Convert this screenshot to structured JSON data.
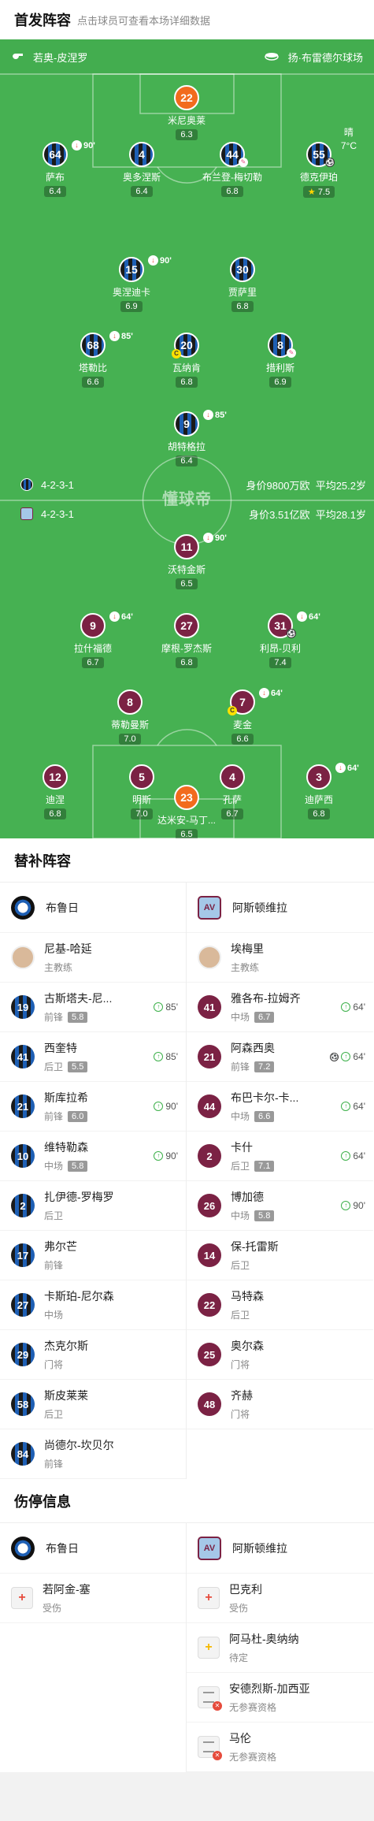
{
  "header": {
    "title": "首发阵容",
    "subtitle": "点击球员可查看本场详细数据"
  },
  "pitch": {
    "home_coach_label": "若奥-皮涅罗",
    "venue": "扬·布雷德尔球场",
    "weather": "晴",
    "temperature": "7°C",
    "watermark": "懂球帝",
    "home_formation": {
      "formation": "4-2-3-1",
      "value": "身价9800万欧",
      "age": "平均25.2岁"
    },
    "away_formation": {
      "formation": "4-2-3-1",
      "value": "身价3.51亿欧",
      "age": "平均28.1岁"
    },
    "home_players": [
      {
        "number": "22",
        "name": "米尼奥莱",
        "rating": "6.3"
      },
      {
        "number": "64",
        "name": "萨布",
        "rating": "6.4",
        "sub_minute": "90'"
      },
      {
        "number": "4",
        "name": "奥多涅斯",
        "rating": "6.4"
      },
      {
        "number": "44",
        "name": "布兰登-梅切勒",
        "rating": "6.8"
      },
      {
        "number": "55",
        "name": "德克伊珀",
        "rating": "7.5"
      },
      {
        "number": "15",
        "name": "奥涅迪卡",
        "rating": "6.9",
        "sub_minute": "90'"
      },
      {
        "number": "30",
        "name": "贾萨里",
        "rating": "6.8"
      },
      {
        "number": "68",
        "name": "塔勒比",
        "rating": "6.6",
        "sub_minute": "85'"
      },
      {
        "number": "20",
        "name": "瓦纳肯",
        "rating": "6.8"
      },
      {
        "number": "8",
        "name": "措利斯",
        "rating": "6.9"
      },
      {
        "number": "9",
        "name": "胡特格拉",
        "rating": "6.4",
        "sub_minute": "85'"
      }
    ],
    "away_players": [
      {
        "number": "11",
        "name": "沃特金斯",
        "rating": "6.5",
        "sub_minute": "90'"
      },
      {
        "number": "9",
        "name": "拉什福德",
        "rating": "6.7",
        "sub_minute": "64'"
      },
      {
        "number": "27",
        "name": "摩根-罗杰斯",
        "rating": "6.8"
      },
      {
        "number": "31",
        "name": "利昂-贝利",
        "rating": "7.4",
        "sub_minute": "64'"
      },
      {
        "number": "8",
        "name": "蒂勒曼斯",
        "rating": "7.0"
      },
      {
        "number": "7",
        "name": "麦金",
        "rating": "6.6",
        "sub_minute": "64'"
      },
      {
        "number": "12",
        "name": "迪涅",
        "rating": "6.8"
      },
      {
        "number": "5",
        "name": "明斯",
        "rating": "7.0"
      },
      {
        "number": "4",
        "name": "孔萨",
        "rating": "6.7"
      },
      {
        "number": "3",
        "name": "迪萨西",
        "rating": "6.8",
        "sub_minute": "64'"
      },
      {
        "number": "23",
        "name": "达米安-马丁...",
        "rating": "6.5"
      }
    ]
  },
  "subs": {
    "title": "替补阵容",
    "home_team": "布鲁日",
    "away_team": "阿斯顿维拉",
    "away_logo_text": "AV",
    "home_coach": {
      "name": "尼基-哈延",
      "role": "主教练"
    },
    "away_coach": {
      "name": "埃梅里",
      "role": "主教练"
    },
    "home": [
      {
        "number": "19",
        "name": "古斯塔夫-尼...",
        "pos": "前锋",
        "rating": "5.8",
        "minute": "85'"
      },
      {
        "number": "41",
        "name": "西奎特",
        "pos": "后卫",
        "rating": "5.5",
        "minute": "85'"
      },
      {
        "number": "21",
        "name": "斯库拉希",
        "pos": "前锋",
        "rating": "6.0",
        "minute": "90'"
      },
      {
        "number": "10",
        "name": "维特勒森",
        "pos": "中场",
        "rating": "5.8",
        "minute": "90'"
      },
      {
        "number": "2",
        "name": "扎伊德-罗梅罗",
        "pos": "后卫"
      },
      {
        "number": "17",
        "name": "弗尔芒",
        "pos": "前锋"
      },
      {
        "number": "27",
        "name": "卡斯珀-尼尔森",
        "pos": "中场"
      },
      {
        "number": "29",
        "name": "杰克尔斯",
        "pos": "门将"
      },
      {
        "number": "58",
        "name": "斯皮莱莱",
        "pos": "后卫"
      },
      {
        "number": "84",
        "name": "尚德尔-坎贝尔",
        "pos": "前锋"
      }
    ],
    "away": [
      {
        "number": "41",
        "name": "雅各布-拉姆齐",
        "pos": "中场",
        "rating": "6.7",
        "minute": "64'"
      },
      {
        "number": "21",
        "name": "阿森西奥",
        "pos": "前锋",
        "rating": "7.2",
        "minute": "64'"
      },
      {
        "number": "44",
        "name": "布巴卡尔-卡...",
        "pos": "中场",
        "rating": "6.6",
        "minute": "64'"
      },
      {
        "number": "2",
        "name": "卡什",
        "pos": "后卫",
        "rating": "7.1",
        "minute": "64'"
      },
      {
        "number": "26",
        "name": "博加德",
        "pos": "中场",
        "rating": "5.8",
        "minute": "90'"
      },
      {
        "number": "14",
        "name": "保-托雷斯",
        "pos": "后卫"
      },
      {
        "number": "22",
        "name": "马特森",
        "pos": "后卫"
      },
      {
        "number": "25",
        "name": "奥尔森",
        "pos": "门将"
      },
      {
        "number": "48",
        "name": "齐赫",
        "pos": "门将"
      }
    ]
  },
  "injuries": {
    "title": "伤停信息",
    "home_team": "布鲁日",
    "away_team": "阿斯顿维拉",
    "home": [
      {
        "name": "若阿金-塞",
        "status": "受伤"
      }
    ],
    "away": [
      {
        "name": "巴克利",
        "status": "受伤"
      },
      {
        "name": "阿马杜-奥纳纳",
        "status": "待定"
      },
      {
        "name": "安德烈斯-加西亚",
        "status": "无参赛资格"
      },
      {
        "name": "马伦",
        "status": "无参赛资格"
      }
    ]
  }
}
